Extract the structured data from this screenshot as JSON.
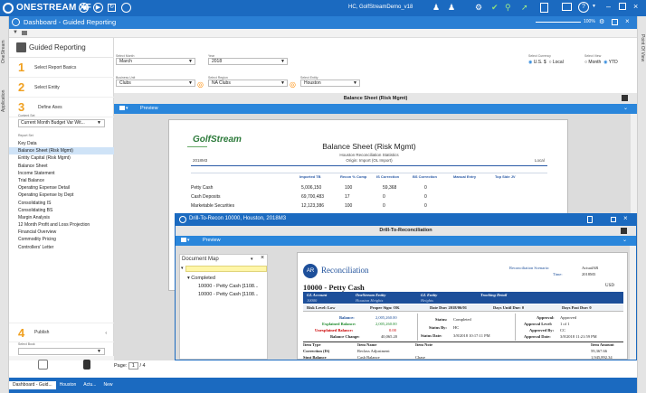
{
  "app": {
    "logo": "ONESTREAM XF",
    "user_info": "HC, GolfStreamDemo_v18",
    "page_title": "Dashboard - Guided Reporting",
    "zoom": "100%"
  },
  "strips": {
    "left_labels": [
      "OneStream",
      "Application"
    ],
    "right_label": "Point Of View"
  },
  "guided": {
    "title": "Guided Reporting",
    "hide_label": "Hide",
    "steps": [
      {
        "num": "1",
        "label": "Select Report Basics"
      },
      {
        "num": "2",
        "label": "Select Entity"
      },
      {
        "num": "3",
        "label": "Define Axes"
      }
    ],
    "content_label": "Content Set",
    "content_value": "Current Month Budget Var Wit...",
    "report_set_label": "Report Set",
    "reports": [
      "Key Data",
      "Balance Sheet (Risk Mgmt)",
      "Entity Capital (Risk Mgmt)",
      "Balance Sheet",
      "Income Statement",
      "Trial Balance",
      "Operating Expense Detail",
      "Operating Expense by Dept",
      "Consolidating IS",
      "Consolidating BS",
      "Margin Analysis",
      "12 Month Profit and Loss Projection",
      "Financial Overview",
      "Commodity Pricing",
      "Controllers' Letter"
    ],
    "selected_report": 1,
    "publish": {
      "num": "4",
      "label": "Publish"
    },
    "select_book_label": "Select Book"
  },
  "filters": {
    "month_label": "Select Month",
    "month_value": "March",
    "year_label": "Year",
    "year_value": "2018",
    "currency_label": "Select Currency",
    "currency_options": [
      "U.S. $",
      "Local"
    ],
    "view_label": "Select View",
    "view_options": [
      "Month",
      "YTD"
    ],
    "bu_label": "Business Unit",
    "bu_value": "Clubs",
    "region_label": "Select Region",
    "region_value": "NA Clubs",
    "entity_label": "Select Entity",
    "entity_value": "Houston"
  },
  "report": {
    "header": "Balance Sheet (Risk Mgmt)",
    "preview_label": "Preview",
    "logo_text": "GolfStream",
    "title": "Balance Sheet (Risk Mgmt)",
    "subtitle1": "Houston Reconciliation Statistics",
    "subtitle2": "Origin: Import (OL Import)",
    "period": "2018M3",
    "currency_label": "Local",
    "columns": [
      "Imported TB",
      "Recon % Comp",
      "IS Correction",
      "BS Correction",
      "Manual Entry",
      "Top Side JV"
    ],
    "rows": [
      {
        "name": "Petty Cash",
        "values": [
          "5,006,150",
          "100",
          "59,368",
          "0"
        ]
      },
      {
        "name": "Cash Deposits",
        "values": [
          "69,700,483",
          "17",
          "0",
          "0"
        ]
      },
      {
        "name": "Marketable Securities",
        "values": [
          "12,123,386",
          "100",
          "0",
          "0"
        ]
      }
    ],
    "page_label": "Page:",
    "page_num": "1",
    "page_total": "/ 4"
  },
  "drill": {
    "window_title": "Drill-To-Recon 10000, Houston, 2018M3",
    "header": "Drill-To-Reconciliation",
    "preview_label": "Preview",
    "doc_map_title": "Document Map",
    "doc_map_items": [
      "Completed",
      "10000 - Petty Cash [1108...",
      "10000 - Petty Cash [1108..."
    ],
    "recon": {
      "ar_logo": "AR",
      "title": "Reconciliation",
      "scenario_label": "Reconciliation Scenario:",
      "scenario_value": "ActualAR",
      "time_label": "Time:",
      "time_value": "2018M3",
      "account_title": "10000 - Petty Cash",
      "currency": "USD",
      "gl_headers": [
        "GL Account",
        "OneStream Entity",
        "GL Entity",
        "Tracking Detail"
      ],
      "gl_values": [
        "10000",
        "Houston Heights",
        "Heights",
        ""
      ],
      "risk_level": "Risk Level: Low",
      "proper_sign": "Proper Sign: OK",
      "date_due": "Date Due: 2018/06/01",
      "days_until": "Days Until Due: 0",
      "days_past": "Days Past Due: 0",
      "balance_label": "Balance:",
      "balance_value": "2,005,260.00",
      "explained_label": "Explained Balance:",
      "explained_value": "2,005,260.00",
      "unexplained_label": "Unexplained Balance:",
      "unexplained_value": "0.00",
      "change_label": "Balance Change:",
      "change_value": "40,065.20",
      "status_label": "Status:",
      "status_value": "Completed",
      "status_by_label": "Status By:",
      "status_by_value": "HC",
      "status_date_label": "Status Date:",
      "status_date_value": "3/8/2018 10:17:11 PM",
      "approval_label": "Approval:",
      "approval_value": "Approved",
      "approval_level_label": "Approval Level:",
      "approval_level_value": "1 of 1",
      "approved_by_label": "Approved By:",
      "approved_by_value": "CC",
      "approval_date_label": "Approval Date:",
      "approval_date_value": "3/8/2018 11:21:59 PM",
      "item_headers": [
        "Item Type",
        "Item Name",
        "Item Note",
        "Item Amount"
      ],
      "items": [
        {
          "type": "Correction (IS)",
          "name": "Reclass Adjustment",
          "note": "",
          "amount": "59,367.66"
        },
        {
          "type": "Stmt Balance",
          "name": "Cash Balance",
          "note": "Chase",
          "amount": "1,945,892.34"
        }
      ]
    }
  },
  "bottom_tabs": [
    "Dashboard - Guid...",
    "Houston",
    "Actu...",
    "New"
  ],
  "colors": {
    "brand_blue": "#1b6ac0",
    "bar_blue": "#2a86db",
    "accent_orange": "#f0a020",
    "unexplained_red": "#cc0000"
  }
}
